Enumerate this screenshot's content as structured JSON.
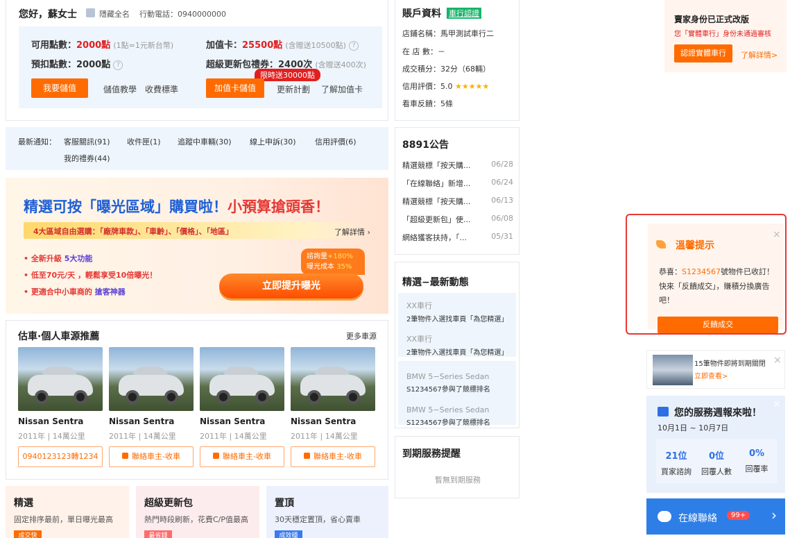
{
  "greeting": {
    "hello": "您好，蘇女士",
    "hide_name": "隱藏全名",
    "phone": "行動電話：0940000000"
  },
  "points": {
    "available_label": "可用點數：",
    "available_value": "2000點",
    "available_note": "(1點=1元新台幣)",
    "prepaid_label": "預扣點數：",
    "prepaid_value": "2000點",
    "store_label": "加值卡：",
    "store_value": "25500點",
    "store_note": "(含贈送10500點)",
    "refresh_label": "超級更新包禮券：",
    "refresh_value": "2400次",
    "refresh_note": "(含贈送400次)",
    "limited_badge": "限時送30000點",
    "btn_topup": "我要儲值",
    "link_teach": "儲值教學",
    "link_fee": "收費標準",
    "btn_card": "加值卡儲值",
    "link_plan": "更新計劃",
    "link_card": "了解加值卡"
  },
  "account": {
    "title": "賬戶資料",
    "verify_badge": "車行認證",
    "store": "店鋪名稱：馬甲測試車行二",
    "in_store": "在 店 數：－",
    "score": "成交積分：32分（68輛）",
    "credit_label": "信用評價：5.0",
    "stars": "★★★★★",
    "feedback": "看車反饋：5條"
  },
  "notice": {
    "label": "最新通知：",
    "items": [
      "客服關訊(91)",
      "收件匣(1)",
      "追蹤中車輛(30)",
      "線上申訴(30)",
      "信用評價(6)"
    ],
    "gift": "我的禮券(44)"
  },
  "banner": {
    "title_a": "精選可按「曝光區域」購買啦！",
    "title_b": "小預算搶頭香！",
    "sub": "4大區域自由選購：「廠牌車款」、「車齡」、「價格」、「地區」",
    "more": "了解詳情 ›",
    "b1a": "• 全新升級 ",
    "b1b": "5大功能",
    "b2a": "• 低至70元/天 ，輕鬆享受10倍曝光！",
    "b3a": "• 更適合中小車商的 ",
    "b3b": "搶客神器",
    "s1a": "諮詢量",
    "s1b": "+180%",
    "s2a": "曝光成本 ",
    "s2b": "35%",
    "cta": "立即提升曝光"
  },
  "cars": {
    "title": "估車·個人車源推薦",
    "more": "更多車源",
    "items": [
      {
        "name": "Nissan Sentra",
        "meta": "2011年 | 14萬公里",
        "btn": "0940123123轉1234"
      },
      {
        "name": "Nissan Sentra",
        "meta": "2011年 | 14萬公里",
        "btn": "聯絡車主-收車"
      },
      {
        "name": "Nissan Sentra",
        "meta": "2011年 | 14萬公里",
        "btn": "聯絡車主-收車"
      },
      {
        "name": "Nissan Sentra",
        "meta": "2011年 | 14萬公里",
        "btn": "聯絡車主-收車"
      }
    ]
  },
  "announce": {
    "title": "8891公告",
    "items": [
      {
        "t": "精選競標「按天購...",
        "d": "06/28"
      },
      {
        "t": "「在線聯絡」新增...",
        "d": "06/24"
      },
      {
        "t": "精選競標「按天購...",
        "d": "06/13"
      },
      {
        "t": "「超級更新包」使...",
        "d": "06/08"
      },
      {
        "t": "網絡獲客扶持，「...",
        "d": "05/31"
      }
    ]
  },
  "news": {
    "title": "精選−最新動態",
    "items": [
      {
        "a": "XX車行",
        "b": "2筆物件入選找車頁「為您精選」"
      },
      {
        "a": "XX車行",
        "b": "2筆物件入選找車頁「為您精選」"
      },
      {
        "a": "BMW 5−Series Sedan",
        "b": "S1234567參與了競標排名"
      },
      {
        "a": "BMW 5−Series Sedan",
        "b": "S1234567參與了競標排名"
      }
    ]
  },
  "expire": {
    "title": "到期服務提醒",
    "empty": "暫無到期服務"
  },
  "products": [
    {
      "name": "精選",
      "desc": "固定排序最前，單日曝光最高",
      "tag": "成交快"
    },
    {
      "name": "超級更新包",
      "desc": "熱門時段刷新，花費C/P值最高",
      "tag": "最省錢"
    },
    {
      "name": "置頂",
      "desc": "30天穩定置頂，省心賣車",
      "tag": "成效穩"
    }
  ],
  "seller": {
    "title": "賣家身份已正式改版",
    "warn": "您「實體車行」身份未通過審核",
    "btn": "認證實體車行",
    "link": "了解詳情>"
  },
  "tip": {
    "title": "溫馨提示",
    "p1": "恭喜：",
    "p1id": "S1234567",
    "p1b": "號物件已收訂！",
    "p2": "快來「反饋成交」，賺積分換廣告吧！",
    "btn": "反饋成交",
    "close": "×"
  },
  "expiring": {
    "text": "15筆物件即將到期關閉",
    "link": "立即查看>",
    "close": "×"
  },
  "weekly": {
    "title": "您的服務週報來啦！",
    "range": "10月1日 ~ 10月7日",
    "close": "×",
    "stats": [
      {
        "v": "21位",
        "l": "買家諮詢"
      },
      {
        "v": "0位",
        "l": "回覆人數"
      },
      {
        "v": "0%",
        "l": "回覆率"
      }
    ]
  },
  "chat": {
    "label": "在線聯絡",
    "badge": "99+",
    "arrow": "›"
  },
  "colors": {
    "accent": "#ff6b00",
    "red": "#e02020",
    "light_blue": "#eef5fd",
    "highlight": "#e53935"
  }
}
